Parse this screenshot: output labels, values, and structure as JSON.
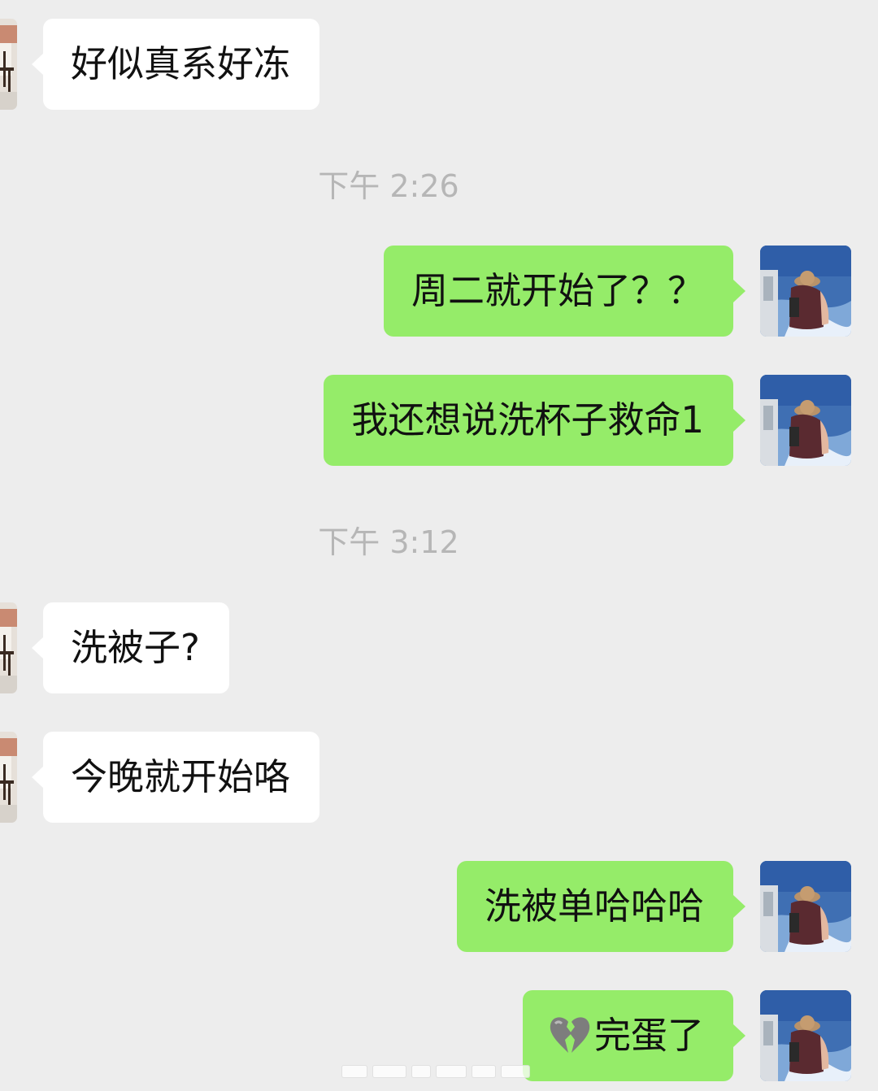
{
  "chat": {
    "time1": "下午 2:26",
    "time2": "下午 3:12",
    "messages": [
      {
        "from": "other",
        "text": "好似真系好冻"
      },
      {
        "from": "self",
        "text": "周二就开始了？？"
      },
      {
        "from": "self",
        "text": "我还想说洗杯子救命1"
      },
      {
        "from": "other",
        "text": "洗被子?"
      },
      {
        "from": "other",
        "text": "今晚就开始咯"
      },
      {
        "from": "self",
        "text": "洗被单哈哈哈"
      },
      {
        "from": "self",
        "emoji": "broken-heart-icon",
        "text": "完蛋了"
      }
    ]
  },
  "colors": {
    "background": "#ededed",
    "incoming_bubble": "#ffffff",
    "outgoing_bubble": "#95ec69",
    "timestamp": "#b6b6b6",
    "broken_heart": "#7d7d7d"
  },
  "avatars": {
    "self": "sea-photo-avatar",
    "other": "person-photo-avatar"
  }
}
